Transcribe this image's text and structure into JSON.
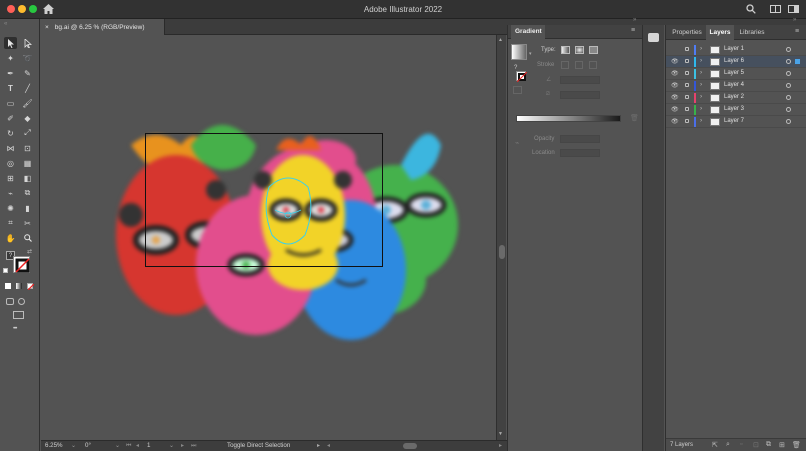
{
  "window": {
    "title": "Adobe Illustrator 2022"
  },
  "document_tab": {
    "close_glyph": "×",
    "label": "bg.ai @ 6.25 % (RGB/Preview)"
  },
  "status_bar": {
    "zoom": "6.25%",
    "rotation": "0°",
    "artboard_number": "1",
    "tool_status": "Toggle Direct Selection"
  },
  "gradient_panel": {
    "tab": "Gradient",
    "type_label": "Type:",
    "stroke_label": "Stroke",
    "opacity_label": "Opacity",
    "location_label": "Location",
    "swap_glyph": "?"
  },
  "layers_panel": {
    "tabs": [
      "Properties",
      "Layers",
      "Libraries"
    ],
    "active_tab": "Layers",
    "footer_count": "7 Layers",
    "layers": [
      {
        "name": "Layer 1",
        "color": "#4f7cf5",
        "visible": false,
        "selected": false
      },
      {
        "name": "Layer 6",
        "color": "#2fb8ec",
        "visible": true,
        "selected": true
      },
      {
        "name": "Layer 5",
        "color": "#3cc1e3",
        "visible": true,
        "selected": false
      },
      {
        "name": "Layer 4",
        "color": "#3456d8",
        "visible": true,
        "selected": false
      },
      {
        "name": "Layer 2",
        "color": "#e6426c",
        "visible": true,
        "selected": false
      },
      {
        "name": "Layer 3",
        "color": "#38b24a",
        "visible": true,
        "selected": false
      },
      {
        "name": "Layer 7",
        "color": "#4b6ee8",
        "visible": true,
        "selected": false
      }
    ]
  },
  "toolbar": {
    "fill_stroke_glyph": "?",
    "more_tools_glyph": "•••"
  },
  "colors": {
    "title_bar": "#323232",
    "panel": "#535353",
    "canvas": "#535353",
    "close_red": "#fe5f57",
    "minimize_yellow": "#febc2e",
    "maximize_green": "#28c840",
    "selection_blue": "#4aa3e8"
  }
}
